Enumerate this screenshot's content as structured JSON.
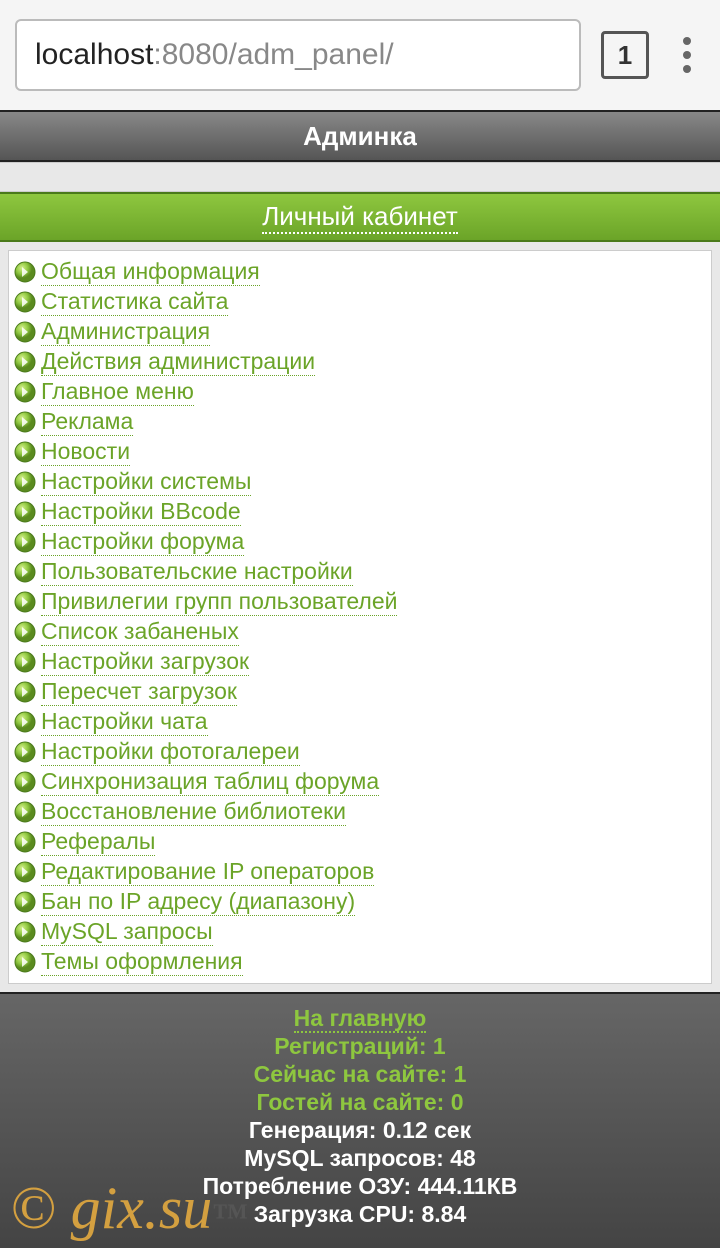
{
  "browser": {
    "url_host": "localhost",
    "url_path": ":8080/adm_panel/",
    "tab_count": "1"
  },
  "title": "Админка",
  "section": "Личный кабинет",
  "menu": [
    "Общая информация",
    "Статистика сайта",
    "Администрация",
    "Действия администрации",
    "Главное меню",
    "Реклама",
    "Новости",
    "Настройки системы",
    "Настройки BBcode",
    "Настройки форума",
    "Пользовательские настройки",
    "Привилегии групп пользователей",
    "Список забаненых",
    "Настройки загрузок",
    "Пересчет загрузок",
    "Настройки чата",
    "Настройки фотогалереи",
    "Синхронизация таблиц форума",
    "Восстановление библиотеки",
    "Рефералы",
    "Редактирование IP операторов",
    "Бан по IP адресу (диапазону)",
    "MySQL запросы",
    "Темы оформления"
  ],
  "footer": {
    "home": "На главную",
    "registrations": "Регистраций: 1",
    "online": "Сейчас на сайте: 1",
    "guests": "Гостей на сайте: 0",
    "generation": "Генерация: 0.12 сек",
    "mysql": "MySQL запросов: 48",
    "ram": "Потребление ОЗУ: 444.11КВ",
    "cpu": "Загрузка CPU: 8.84"
  },
  "watermark": "© gix.su",
  "watermark_tm": "™"
}
